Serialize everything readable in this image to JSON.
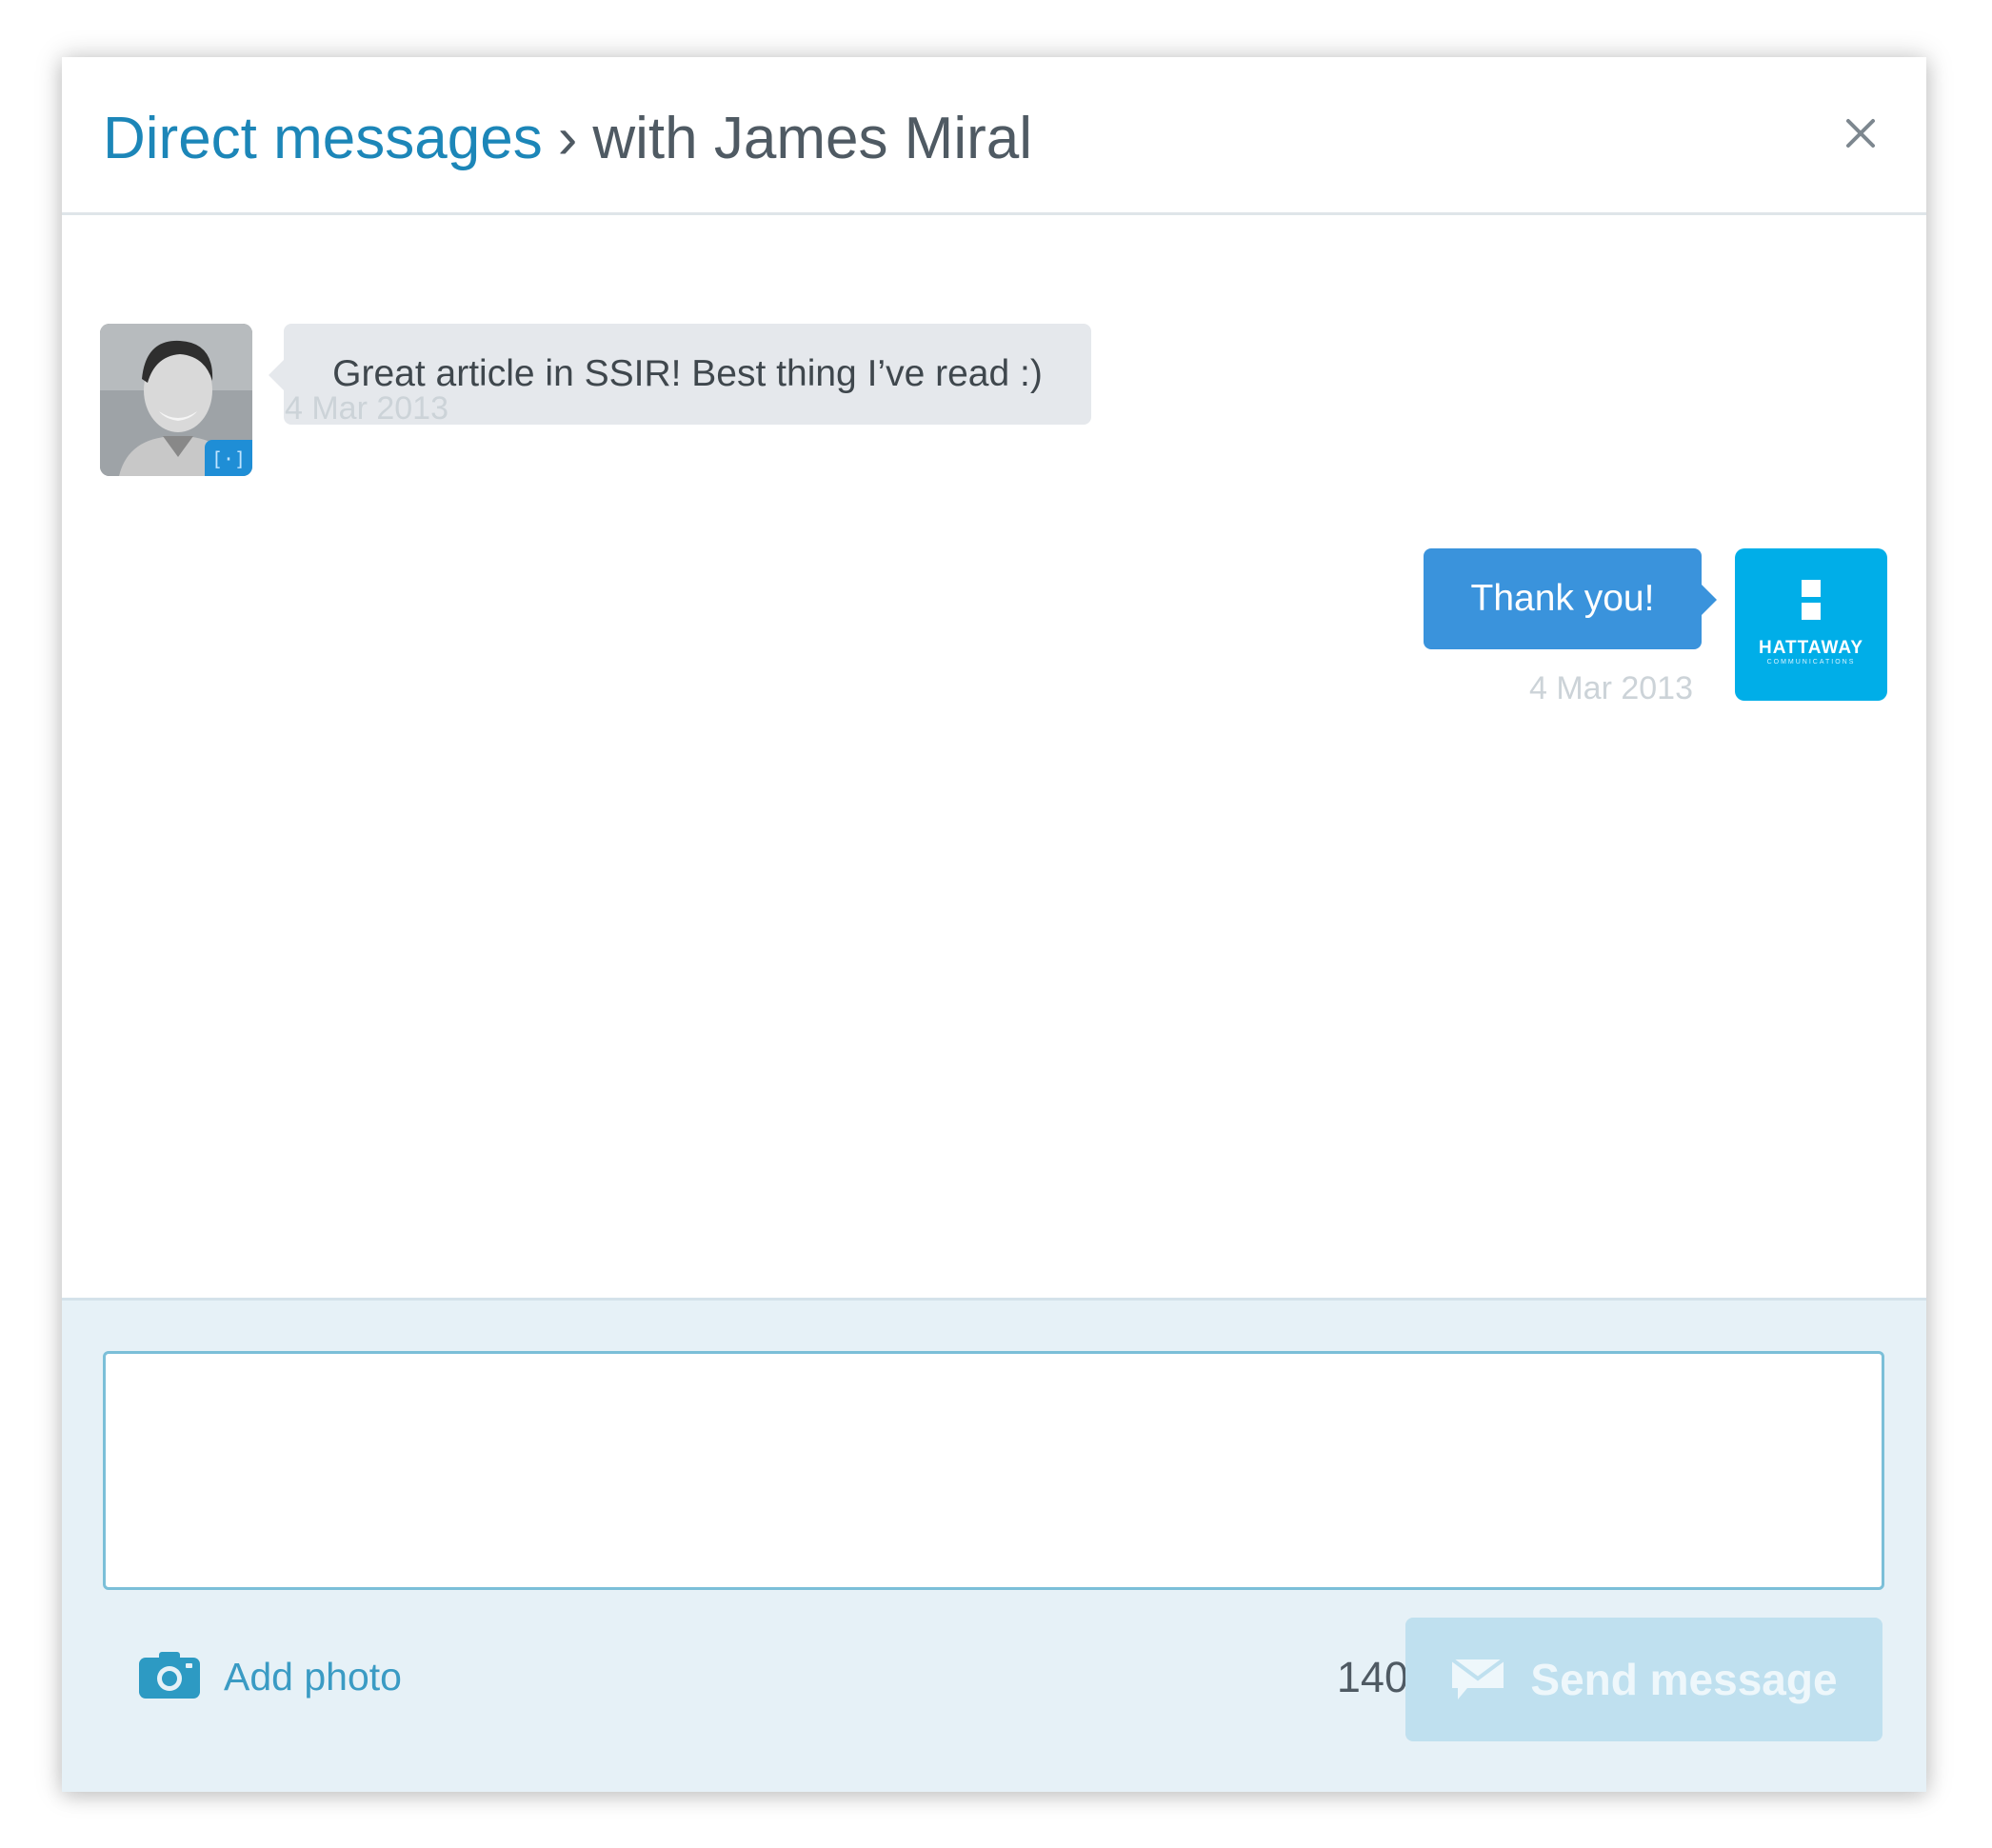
{
  "header": {
    "breadcrumb_link": "Direct messages",
    "separator": "›",
    "conversation_title": "with James Miral",
    "close_icon": "close-icon"
  },
  "messages": [
    {
      "direction": "incoming",
      "sender": "James Miral",
      "avatar": "user-avatar-photo",
      "text": "Great article in SSIR! Best thing I’ve read :)",
      "date": "4 Mar 2013"
    },
    {
      "direction": "outgoing",
      "avatar": "hattaway-logo",
      "text": "Thank you!",
      "date": "4 Mar 2013"
    }
  ],
  "org_logo": {
    "name": "HATTAWAY",
    "subtitle": "COMMUNICATIONS"
  },
  "composer": {
    "input_value": "",
    "add_photo_label": "Add photo",
    "add_photo_icon": "camera-icon",
    "char_count": "140",
    "send_label": "Send message",
    "send_icon": "envelope-icon",
    "send_enabled": false
  },
  "colors": {
    "link": "#1c86b8",
    "outgoing_bubble": "#3a93dc",
    "incoming_bubble": "#e5e8ec",
    "composer_bg": "#e6f1f7",
    "send_disabled": "#bfe0ef",
    "logo_bg": "#00aee8"
  }
}
